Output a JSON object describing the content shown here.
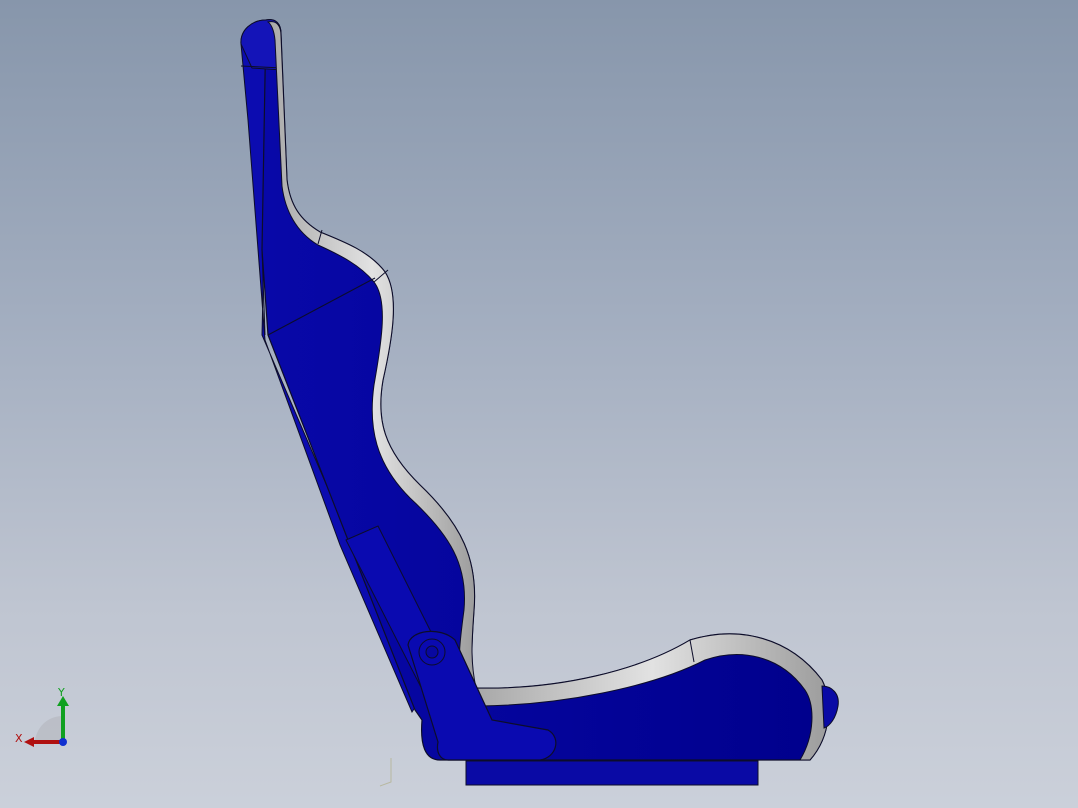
{
  "viewport": {
    "background_top": "#8796ab",
    "background_bottom": "#cbd0da"
  },
  "model": {
    "shell_color": "#0a0aa5",
    "shell_dark_color": "#050585",
    "cushion_color": "#c9c9c9",
    "edge_color": "#0d0d2a"
  },
  "triad": {
    "x_label": "X",
    "y_label": "Y",
    "x_color": "#b01010",
    "y_color": "#10a020",
    "z_color": "#1030d0"
  }
}
